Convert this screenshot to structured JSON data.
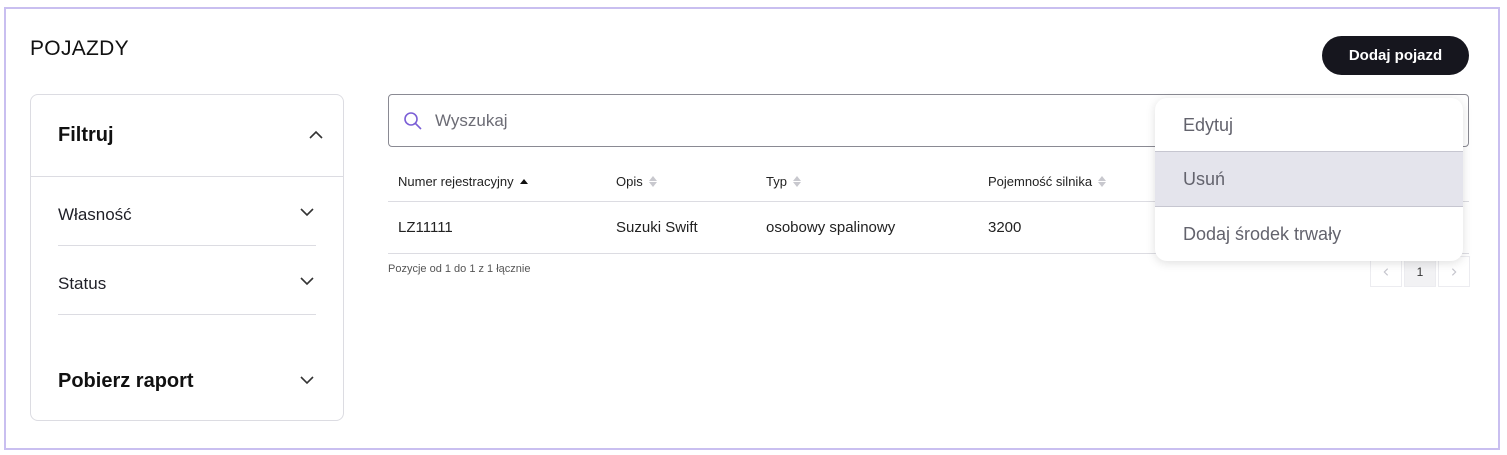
{
  "page": {
    "title": "POJAZDY"
  },
  "toolbar": {
    "add_label": "Dodaj pojazd"
  },
  "filter": {
    "title": "Filtruj",
    "sections": [
      {
        "label": "Własność"
      },
      {
        "label": "Status"
      }
    ],
    "report_label": "Pobierz raport"
  },
  "search": {
    "placeholder": "Wyszukaj",
    "value": ""
  },
  "table": {
    "columns": [
      {
        "label": "Numer rejestracyjny",
        "sort": "asc"
      },
      {
        "label": "Opis",
        "sort": "none"
      },
      {
        "label": "Typ",
        "sort": "none"
      },
      {
        "label": "Pojemność silnika",
        "sort": "none"
      }
    ],
    "rows": [
      [
        "LZ11111",
        "Suzuki Swift",
        "osobowy spalinowy",
        "3200"
      ]
    ]
  },
  "pagination": {
    "info": "Pozycje od 1 do 1 z 1 łącznie",
    "current_page": "1",
    "prev_icon": "chevron-left-icon",
    "next_icon": "chevron-right-icon"
  },
  "context_menu": {
    "items": [
      {
        "label": "Edytuj"
      },
      {
        "label": "Usuń",
        "highlighted": true
      },
      {
        "label": "Dodaj środek trwały"
      }
    ]
  },
  "colors": {
    "accent": "#7b5fd6",
    "frame": "#c9bff0",
    "button_bg": "#16161e",
    "hover_bg": "#e4e4ec"
  }
}
